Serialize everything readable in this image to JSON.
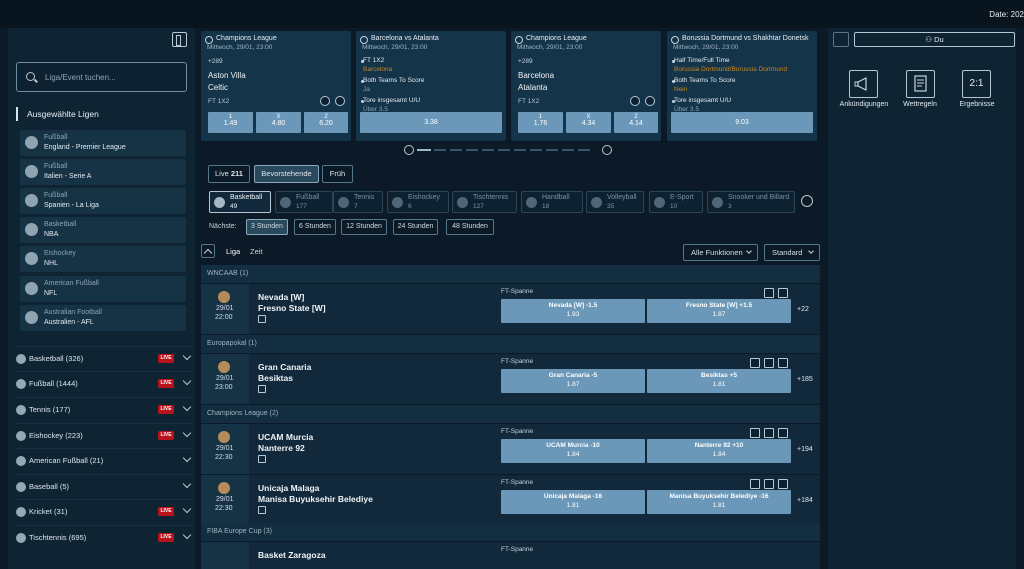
{
  "header": {
    "date_label": "Date: 202"
  },
  "sidebar": {
    "search_placeholder": "Liga/Event tuchen...",
    "selected_leagues_title": "Ausgewählte Ligen",
    "leagues": [
      {
        "sport": "Fußball",
        "league": "England - Premier League",
        "icon": "soccer-ball-icon"
      },
      {
        "sport": "Fußball",
        "league": "Italien - Serie A",
        "icon": "soccer-ball-icon"
      },
      {
        "sport": "Fußball",
        "league": "Spanien - La Liga",
        "icon": "soccer-ball-icon"
      },
      {
        "sport": "Basketball",
        "league": "NBA",
        "icon": "basketball-icon"
      },
      {
        "sport": "Eishockey",
        "league": "NHL",
        "icon": "hockey-puck-icon"
      },
      {
        "sport": "American Fußball",
        "league": "NFL",
        "icon": "american-football-icon"
      },
      {
        "sport": "Australian Football",
        "league": "Australien - AFL",
        "icon": "rugby-ball-icon"
      }
    ],
    "sports": [
      {
        "label": "Basketball (326)",
        "live": "LIVE"
      },
      {
        "label": "Fußball (1444)",
        "live": "LIVE"
      },
      {
        "label": "Tennis (177)",
        "live": "LIVE"
      },
      {
        "label": "Eishockey (223)",
        "live": "LIVE"
      },
      {
        "label": "American Fußball (21)",
        "live": ""
      },
      {
        "label": "Baseball (5)",
        "live": ""
      },
      {
        "label": "Kricket (31)",
        "live": "LIVE"
      },
      {
        "label": "Tischtennis (695)",
        "live": "LIVE"
      }
    ]
  },
  "featured": [
    {
      "competition": "Champions League",
      "date": "Mittwoch, 29/01, 23:00",
      "count": "+289",
      "team1": "Aston Villa",
      "team2": "Celtic",
      "market": "FT 1X2",
      "odds": [
        {
          "label": "1",
          "value": "1.49"
        },
        {
          "label": "X",
          "value": "4.80"
        },
        {
          "label": "2",
          "value": "6.20"
        }
      ]
    },
    {
      "competition": "Barcelona vs Atalanta",
      "date": "Mittwoch, 29/01, 23:00",
      "bets": [
        {
          "m": "FT 1X2",
          "s": "Barcelona"
        },
        {
          "m": "Both Teams To Score",
          "s": "Ja"
        },
        {
          "m": "Tore insgesamt U/U",
          "s": "Über 3.5"
        }
      ],
      "total": "3.38"
    },
    {
      "competition": "Champions League",
      "date": "Mittwoch, 29/01, 23:00",
      "count": "+289",
      "team1": "Barcelona",
      "team2": "Atalanta",
      "market": "FT 1X2",
      "odds": [
        {
          "label": "1",
          "value": "1.76"
        },
        {
          "label": "X",
          "value": "4.34"
        },
        {
          "label": "2",
          "value": "4.14"
        }
      ]
    },
    {
      "competition": "Borussia Dortmund vs Shakhtar Donetsk",
      "date": "Mittwoch, 29/01, 23:00",
      "bets": [
        {
          "m": "Half Time/Full Time",
          "s": "Borussia Dortmund/Borussia Dortmund"
        },
        {
          "m": "Both Teams To Score",
          "s": "Nein"
        },
        {
          "m": "Tore insgesamt U/U",
          "s": "Über 3.5"
        }
      ],
      "total": "9.03"
    }
  ],
  "filters": {
    "live_label": "Live",
    "live_count": "211",
    "upcoming_label": "Bevorstehende",
    "early_label": "Früh"
  },
  "sport_tabs": [
    {
      "name": "Basketball",
      "count": "49"
    },
    {
      "name": "Fußball",
      "count": "177"
    },
    {
      "name": "Tennis",
      "count": "7"
    },
    {
      "name": "Eishockey",
      "count": "6"
    },
    {
      "name": "Tischtennis",
      "count": "127"
    },
    {
      "name": "Handball",
      "count": "18"
    },
    {
      "name": "Volleyball",
      "count": "35"
    },
    {
      "name": "E-Sport",
      "count": "10"
    },
    {
      "name": "Snooker und Billard",
      "count": "3"
    }
  ],
  "hours": {
    "label": "Nächste:",
    "options": [
      "3 Stunden",
      "6 Stunden",
      "12 Stunden",
      "24 Stunden",
      "48 Stunden"
    ]
  },
  "list_controls": {
    "liga": "Liga",
    "zeit": "Zeit",
    "functions": "Alle Funktionen",
    "standard": "Standard"
  },
  "sections": [
    {
      "title": "WNCAAB (1)"
    },
    {
      "title": "Europapokal (1)"
    },
    {
      "title": "Champions League (2)"
    },
    {
      "title": "FIBA Europe Cup (3)"
    }
  ],
  "events": [
    {
      "date": "29/01",
      "time": "22:00",
      "team1": "Nevada [W]",
      "team2": "Fresno State [W]",
      "market": "FT-Spanne",
      "odds": [
        {
          "n": "Nevada [W]  -1.5",
          "v": "1.93"
        },
        {
          "n": "Fresno State [W]  +1.5",
          "v": "1.87"
        }
      ],
      "more": "+22"
    },
    {
      "date": "29/01",
      "time": "23:00",
      "team1": "Gran Canaria",
      "team2": "Besiktas",
      "market": "FT-Spanne",
      "odds": [
        {
          "n": "Gran Canaria  -5",
          "v": "1.87"
        },
        {
          "n": "Besiktas  +5",
          "v": "1.81"
        }
      ],
      "more": "+185"
    },
    {
      "date": "29/01",
      "time": "22:30",
      "team1": "UCAM Murcia",
      "team2": "Nanterre 92",
      "market": "FT-Spanne",
      "odds": [
        {
          "n": "UCAM Murcia  -10",
          "v": "1.84"
        },
        {
          "n": "Nanterre 92  +10",
          "v": "1.84"
        }
      ],
      "more": "+194"
    },
    {
      "date": "29/01",
      "time": "22:30",
      "team1": "Unicaja Malaga",
      "team2": "Manisa Buyuksehir Belediye",
      "market": "FT-Spanne",
      "odds": [
        {
          "n": "Unicaja Malaga  -16",
          "v": "1.81"
        },
        {
          "n": "Manisa Buyuksehir Belediye  -16",
          "v": "1.81"
        }
      ],
      "more": "+184"
    },
    {
      "team1": "Basket Zaragoza",
      "market": "FT-Spanne"
    }
  ],
  "right_panel": {
    "user": "Du",
    "quick": [
      {
        "label": "Ankündigungen",
        "icon": "megaphone-icon"
      },
      {
        "label": "Wettregeln",
        "icon": "rules-icon"
      },
      {
        "label": "Ergebnisse",
        "icon": "results-icon",
        "text": "2:1"
      }
    ]
  }
}
